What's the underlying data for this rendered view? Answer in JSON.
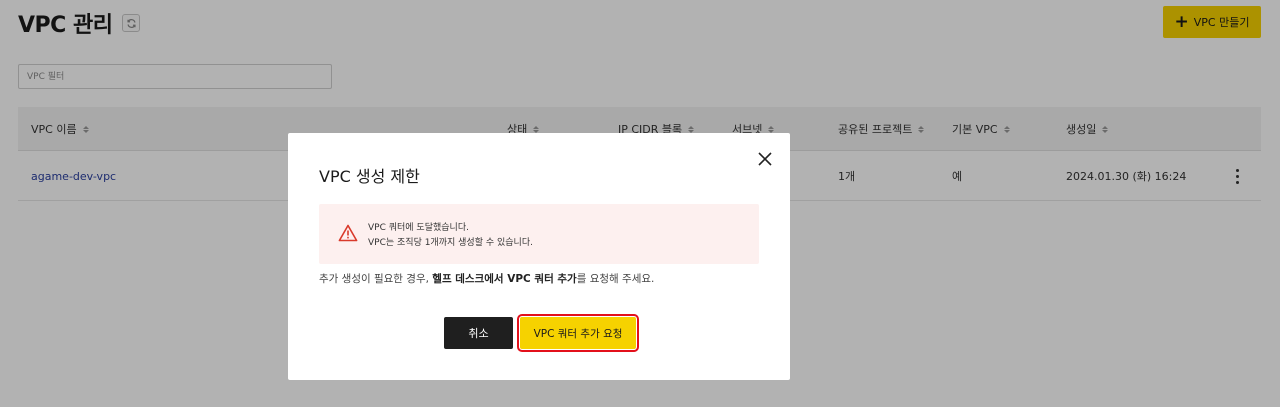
{
  "header": {
    "title": "VPC 관리",
    "create_button": "VPC 만들기"
  },
  "filter": {
    "placeholder": "VPC 필터"
  },
  "table": {
    "columns": [
      "VPC 이름",
      "상태",
      "IP CIDR 블록",
      "서브넷",
      "공유된 프로젝트",
      "기본 VPC",
      "생성일"
    ],
    "rows": [
      {
        "name": "agame-dev-vpc",
        "shared_projects": "1개",
        "default_vpc": "예",
        "created": "2024.01.30 (화) 16:24"
      }
    ]
  },
  "modal": {
    "title": "VPC 생성 제한",
    "alert_line1": "VPC 쿼터에 도달했습니다.",
    "alert_line2": "VPC는 조직당 1개까지 생성할 수 있습니다.",
    "desc_prefix": "추가 생성이 필요한 경우, ",
    "desc_bold": "헬프 데스크에서 VPC 쿼터 추가",
    "desc_suffix": "를 요청해 주세요.",
    "cancel_label": "취소",
    "request_label": "VPC 쿼터 추가 요청"
  },
  "colors": {
    "accent": "#f6d200",
    "highlight": "#e3101b",
    "alert_icon": "#d93a2b",
    "link": "#2a3fa0"
  }
}
